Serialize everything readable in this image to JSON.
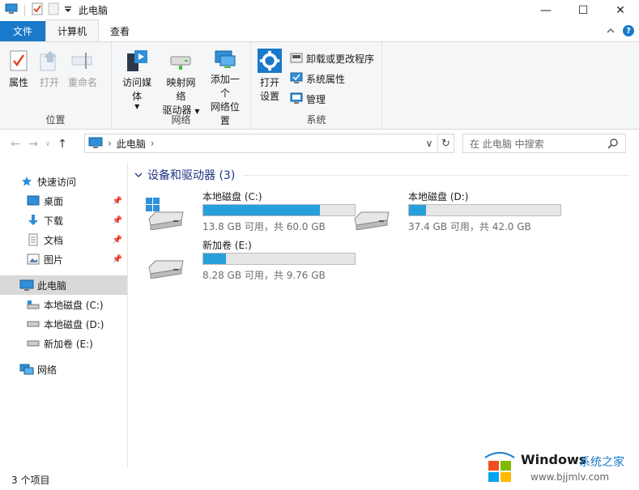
{
  "window": {
    "title": "此电脑",
    "controls": {
      "minimize": "—",
      "maximize": "☐",
      "close": "✕"
    }
  },
  "tabs": [
    {
      "label": "文件"
    },
    {
      "label": "计算机"
    },
    {
      "label": "查看"
    }
  ],
  "ribbon": {
    "location_group": {
      "label": "位置",
      "properties": "属性",
      "open": "打开",
      "rename": "重命名"
    },
    "network_group": {
      "label": "网络",
      "access_media": "访问媒体",
      "map_drive_line1": "映射网络",
      "map_drive_line2": "驱动器",
      "add_location_line1": "添加一个",
      "add_location_line2": "网络位置"
    },
    "system_group": {
      "label": "系统",
      "open_settings_line1": "打开",
      "open_settings_line2": "设置",
      "uninstall": "卸载或更改程序",
      "system_properties": "系统属性",
      "manage": "管理"
    }
  },
  "address": {
    "path": "此电脑",
    "search_placeholder": "在 此电脑 中搜索"
  },
  "nav": {
    "quick_access": "快速访问",
    "desktop": "桌面",
    "downloads": "下载",
    "documents": "文档",
    "pictures": "图片",
    "this_pc": "此电脑",
    "drive_c": "本地磁盘 (C:)",
    "drive_d": "本地磁盘 (D:)",
    "drive_e": "新加卷 (E:)",
    "network": "网络"
  },
  "content": {
    "group_title": "设备和驱动器 (3)",
    "drives": [
      {
        "name": "本地磁盘 (C:)",
        "info": "13.8 GB 可用，共 60.0 GB",
        "used_fraction": 0.77
      },
      {
        "name": "本地磁盘 (D:)",
        "info": "37.4 GB 可用，共 42.0 GB",
        "used_fraction": 0.11
      },
      {
        "name": "新加卷 (E:)",
        "info": "8.28 GB 可用，共 9.76 GB",
        "used_fraction": 0.15
      }
    ]
  },
  "status": {
    "items_count": "3 个项目"
  },
  "watermark": {
    "brand": "Windows",
    "site_name": "系统之家",
    "url": "www.bjjmlv.com"
  },
  "colors": {
    "accent": "#1979ca",
    "bar_fill": "#26a0da",
    "group_title": "#1e3287"
  }
}
